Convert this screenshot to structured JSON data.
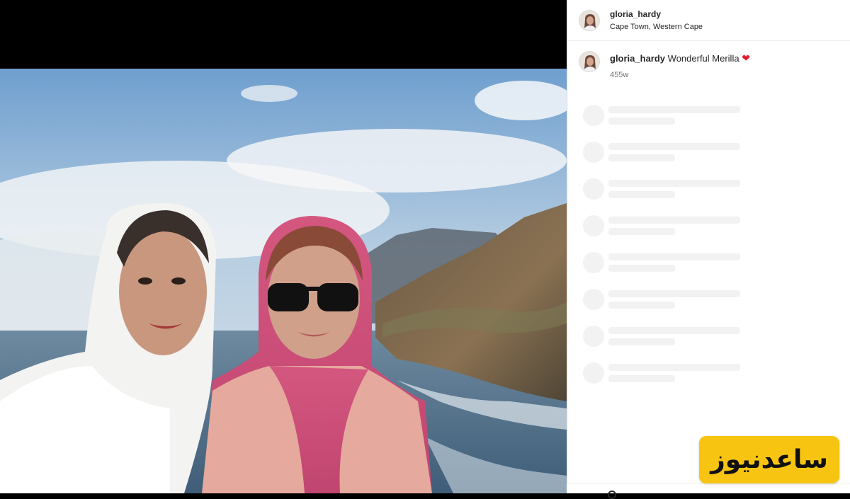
{
  "post": {
    "username": "gloria_hardy",
    "location": "Cape Town, Western Cape"
  },
  "caption": {
    "username": "gloria_hardy",
    "text": "Wonderful Merilla",
    "emoji": "❤",
    "time": "455w"
  },
  "watermark": {
    "text": "ساعدنیوز",
    "color": "#f7c411"
  },
  "icons": {
    "avatar": "profile-photo",
    "heart": "red-heart-emoji"
  },
  "loading_placeholders": 8
}
